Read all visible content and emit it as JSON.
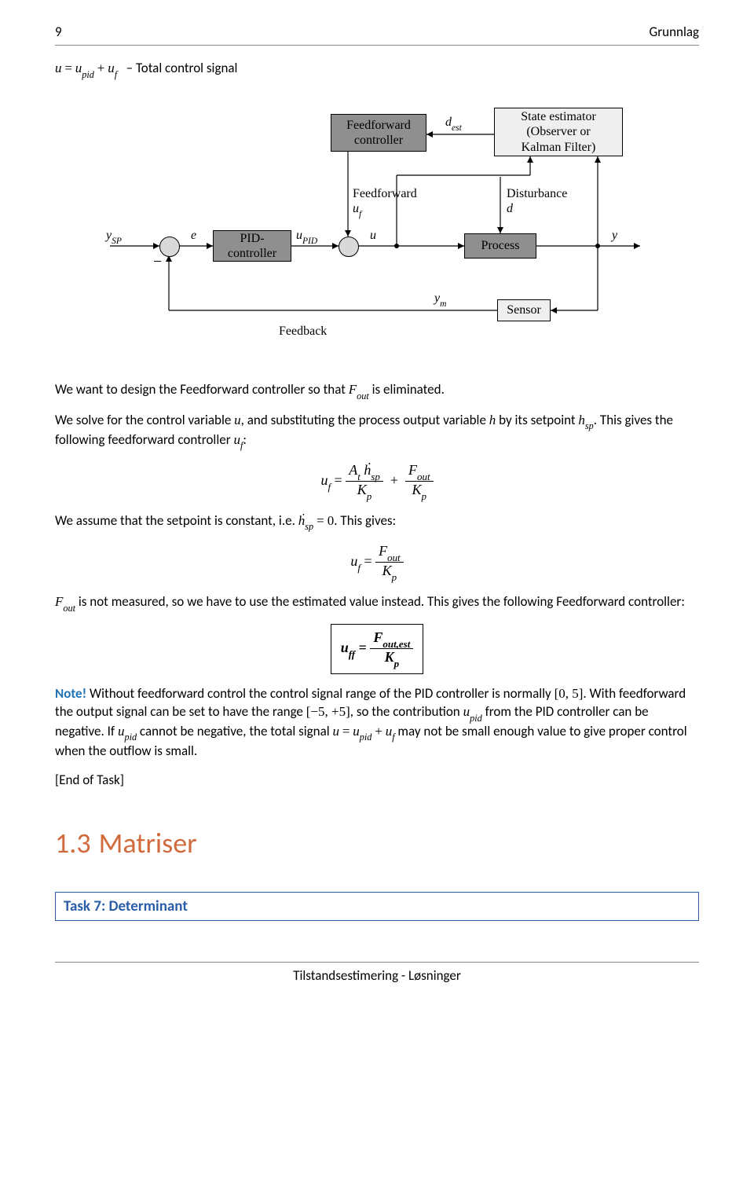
{
  "header": {
    "page_num": "9",
    "chapter": "Grunnlag"
  },
  "intro_eq": {
    "text": "u = u_pid + u_f   – Total control signal"
  },
  "diagram": {
    "ff_controller": "Feedforward\ncontroller",
    "pid_controller": "PID-\ncontroller",
    "state_estimator": "State estimator\n(Observer or\nKalman Filter)",
    "process": "Process",
    "sensor": "Sensor",
    "labels": {
      "y_sp": "y_SP",
      "e": "e",
      "u_pid": "u_PID",
      "u": "u",
      "d_est": "d_est",
      "ff_uf": "Feedforward\nu_f",
      "disturbance": "Disturbance\nd",
      "y": "y",
      "y_m": "y_m",
      "feedback": "Feedback"
    }
  },
  "body": {
    "p1_a": "We want to design the Feedforward controller so that ",
    "p1_b": " is eliminated.",
    "p2_a": "We solve for the control variable ",
    "p2_b": ", and substituting the process output variable ",
    "p2_c": " by its setpoint ",
    "p2_d": ". This gives the following feedforward controller ",
    "p2_e": ":",
    "p3_a": "We assume that the setpoint is constant, i.e. ",
    "p3_b": ". This gives:",
    "p4_a": " is not measured, so we have to use the estimated value instead. This gives the following Feedforward controller:",
    "note_label": "Note!",
    "note_a": " Without feedforward control the control signal range of the PID controller is normally ",
    "note_b": ". With feedforward the output signal can be set to have the range ",
    "note_c": ", so the contribution ",
    "note_d": " from the PID controller can be negative. If ",
    "note_e": " cannot be negative, the total signal ",
    "note_f": " may not be small enough value to give proper control when the outflow is small.",
    "end_task": "[End of Task]"
  },
  "math": {
    "F_out": "F_out",
    "u": "u",
    "h": "h",
    "h_sp": "h_sp",
    "u_f": "u_f",
    "u_pid": "u_pid",
    "hdot_zero": "ḣ_sp = 0",
    "range1": "[0, 5]",
    "range2": "[−5, +5]",
    "total": "u = u_pid + u_f"
  },
  "equations": {
    "eq1": {
      "lhs": "u_f =",
      "t1n": "A_t ḣ_sp",
      "t1d": "K_p",
      "plus": "+",
      "t2n": "F_out",
      "t2d": "K_p"
    },
    "eq2": {
      "lhs": "u_f =",
      "n": "F_out",
      "d": "K_p"
    },
    "eq3": {
      "lhs": "u_ff =",
      "n": "F_out,est",
      "d": "K_p"
    }
  },
  "heading": {
    "num": "1.3",
    "title": "Matriser"
  },
  "task": {
    "label": "Task 7:",
    "title": "Determinant"
  },
  "footer": {
    "text": "Tilstandsestimering - Løsninger"
  }
}
